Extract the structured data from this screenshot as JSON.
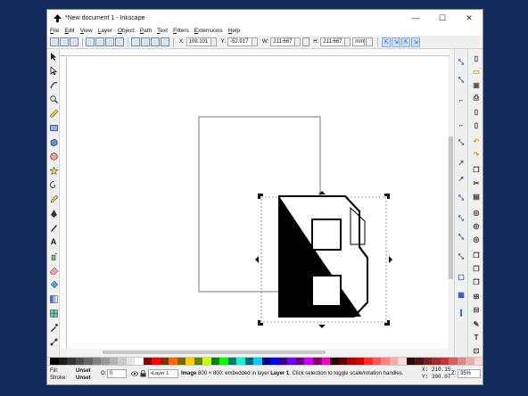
{
  "window": {
    "title": "*New document 1 - Inkscape",
    "minimize": "—",
    "maximize": "☐",
    "close": "✕"
  },
  "menu": [
    "File",
    "Edit",
    "View",
    "Layer",
    "Object",
    "Path",
    "Text",
    "Filters",
    "Extensions",
    "Help"
  ],
  "toolbar": {
    "x_label": "X:",
    "x_value": "108.101",
    "y_label": "Y:",
    "y_value": "-52.917",
    "w_label": "W:",
    "w_value": "211.667",
    "h_label": "H:",
    "h_value": "211.667",
    "unit": "mm"
  },
  "canvas": {
    "image_letter": "B"
  },
  "statusbar": {
    "fill_label": "Fill:",
    "stroke_label": "Stroke:",
    "fill_value": "Unset",
    "stroke_value": "Unset",
    "opacity_label": "O:",
    "opacity_value": "0",
    "layer": "•Layer 1",
    "message_bold": "Image",
    "message_a": "800 × 800: embedded in layer",
    "message_layer": "Layer 1",
    "message_b": ". Click selection to toggle scale/rotation handles.",
    "x_label": "X:",
    "x_value": "210.15",
    "y_label": "Y:",
    "y_value": "390.07",
    "zoom_label": "Z:",
    "zoom_value": "35%"
  },
  "colors": {
    "accent": "#2a5ca8",
    "frame": "#142a5a",
    "selection": "#555555"
  },
  "icons": {
    "left_tools": [
      "selector-arrow-icon",
      "node-tool-icon",
      "tweak-tool-icon",
      "zoom-tool-icon",
      "measure-tool-icon",
      "rectangle-tool-icon",
      "3d-box-tool-icon",
      "ellipse-tool-icon",
      "star-tool-icon",
      "spiral-tool-icon",
      "pencil-tool-icon",
      "pen-tool-icon",
      "calligraphy-tool-icon",
      "text-tool-icon",
      "spray-tool-icon",
      "eraser-tool-icon",
      "paint-bucket-icon",
      "gradient-tool-icon",
      "mesh-tool-icon",
      "dropper-tool-icon",
      "connector-tool-icon"
    ]
  }
}
